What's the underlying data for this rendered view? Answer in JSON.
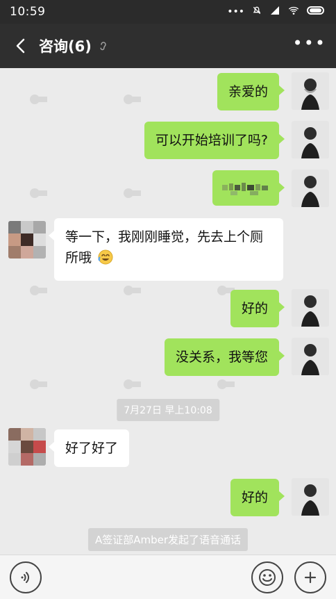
{
  "status_bar": {
    "time": "10:59",
    "icons": [
      "more-icon",
      "mute-icon",
      "signal-icon",
      "wifi-icon",
      "battery-icon"
    ]
  },
  "nav": {
    "back_icon": "back-chevron-icon",
    "title": "咨询(6)",
    "ear_icon": "ear-icon",
    "more_icon": "more-icon"
  },
  "messages": [
    {
      "side": "me",
      "text": "亲爱的"
    },
    {
      "side": "me",
      "text": "可以开始培训了吗?"
    },
    {
      "side": "me",
      "text": ""
    },
    {
      "side": "other",
      "text": "等一下，我刚刚睡觉，先去上个厕所哦"
    },
    {
      "side": "me",
      "text": "好的"
    },
    {
      "side": "me",
      "text": "没关系，我等您"
    },
    {
      "time": "7月27日 早上10:08"
    },
    {
      "side": "other",
      "text": "好了好了"
    },
    {
      "side": "me",
      "text": "好的"
    },
    {
      "system": "A签证部Amber发起了语音通话"
    }
  ],
  "bottom_bar": {
    "voice_icon": "voice-icon",
    "emoji_icon": "emoji-icon",
    "add_icon": "add-icon"
  },
  "colors": {
    "green_bubble": "#a1e35c",
    "white_bubble": "#ffffff",
    "nav_bg": "#2f2f2f",
    "status_bg": "#2b2b2b",
    "chat_bg": "#ebebeb"
  }
}
